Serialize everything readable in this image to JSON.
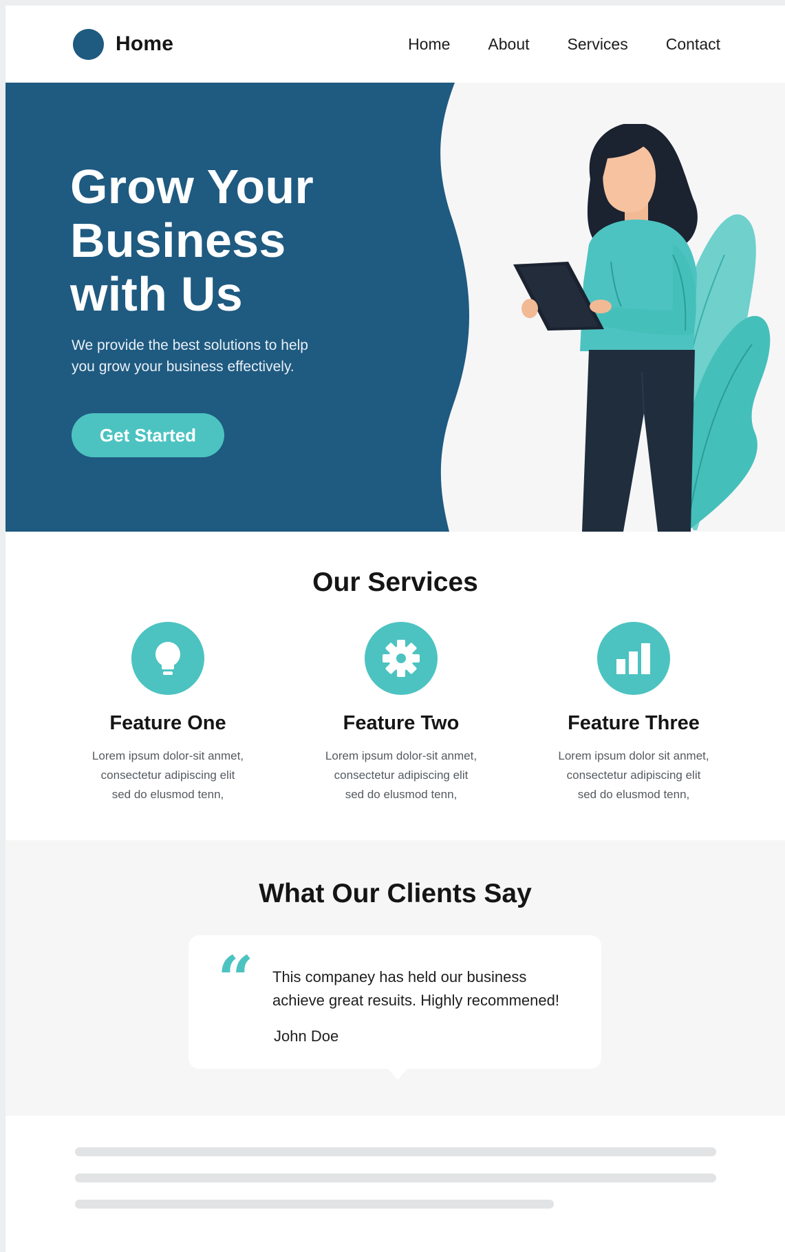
{
  "header": {
    "brand_name": "Home",
    "nav": [
      "Home",
      "About",
      "Services",
      "Contact"
    ]
  },
  "hero": {
    "title_lines": [
      "Grow Your",
      "Business",
      "with Us"
    ],
    "subtitle_lines": [
      "We provide the best solutions to help",
      "you grow your business effectively."
    ],
    "cta_label": "Get Started"
  },
  "services": {
    "title": "Our Services",
    "features": [
      {
        "icon": "lightbulb-icon",
        "title": "Feature One",
        "lines": [
          "Lorem ipsum dolor-sit anmet,",
          "consectetur adipiscing elit",
          "sed do elusmod tenn,"
        ]
      },
      {
        "icon": "gear-icon",
        "title": "Feature Two",
        "lines": [
          "Lorem ipsum dolor-sit anmet,",
          "consectetur adipiscing elit",
          "sed do elusmod tenn,"
        ]
      },
      {
        "icon": "bar-chart-icon",
        "title": "Feature Three",
        "lines": [
          "Lorem ipsum dolor sit anmet,",
          "consectetur adipiscing elit",
          "sed do elusmod tenn,"
        ]
      }
    ]
  },
  "testimonials": {
    "title": "What Our Clients Say",
    "quote_mark": "“",
    "quote_lines": [
      "This companey has held our business",
      "achieve great resuits. Highly recommened!"
    ],
    "author": "John Doe"
  },
  "colors": {
    "primary": "#1f5a80",
    "accent": "#4cc3c1",
    "dark": "#1f2d3d",
    "light_bg": "#f6f6f7"
  }
}
